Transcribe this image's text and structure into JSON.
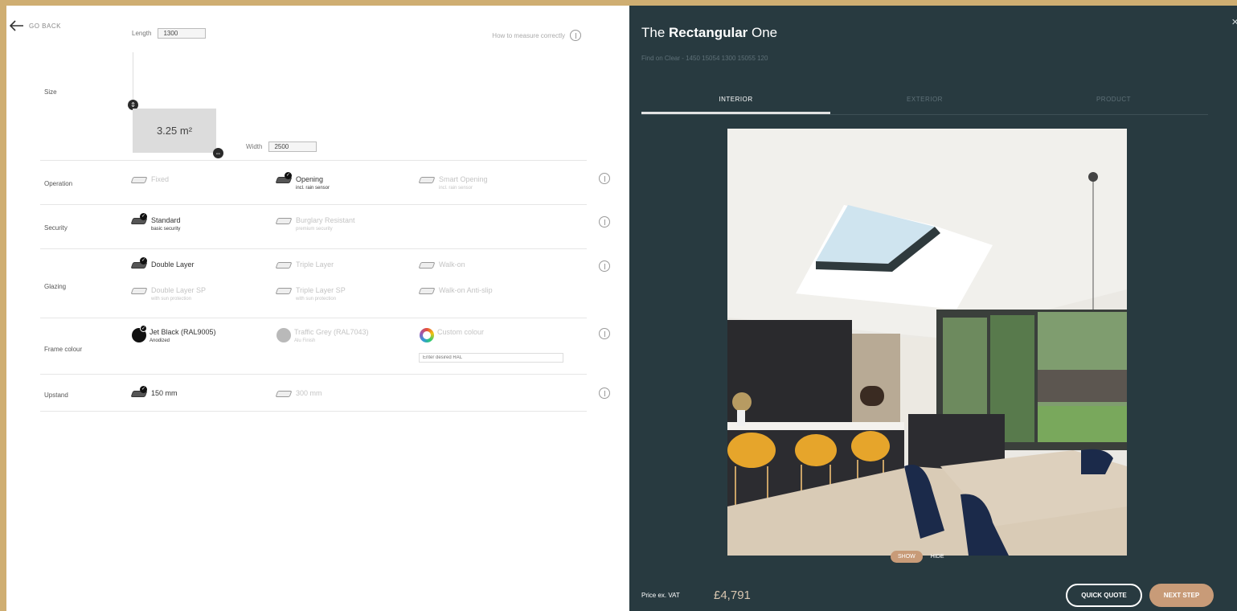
{
  "left": {
    "back_label": "GO BACK",
    "length_label": "Length",
    "length_value": "1300",
    "width_label": "Width",
    "width_value": "2500",
    "measure_link": "How to measure correctly",
    "size_label": "Size",
    "area": "3.25 m²",
    "rows": {
      "operation": {
        "label": "Operation",
        "options": [
          {
            "name": "Fixed",
            "sub": ""
          },
          {
            "name": "Opening",
            "sub": "incl. rain sensor"
          },
          {
            "name": "Smart Opening",
            "sub": "incl. rain sensor"
          }
        ]
      },
      "security": {
        "label": "Security",
        "options": [
          {
            "name": "Standard",
            "sub": "basic security"
          },
          {
            "name": "Burglary Resistant",
            "sub": "premium security"
          }
        ]
      },
      "glazing": {
        "label": "Glazing",
        "options": [
          {
            "name": "Double Layer",
            "sub": ""
          },
          {
            "name": "Triple Layer",
            "sub": ""
          },
          {
            "name": "Walk-on",
            "sub": ""
          },
          {
            "name": "Double Layer SP",
            "sub": "with sun protection"
          },
          {
            "name": "Triple Layer SP",
            "sub": "with sun protection"
          },
          {
            "name": "Walk-on Anti-slip",
            "sub": ""
          }
        ]
      },
      "frame": {
        "label": "Frame colour",
        "options": [
          {
            "name": "Jet Black (RAL9005)",
            "sub": "Anodized"
          },
          {
            "name": "Traffic Grey (RAL7043)",
            "sub": "Alu Finish"
          },
          {
            "name": "Custom colour",
            "sub": ""
          }
        ],
        "custom_placeholder": "Enter desired RAL"
      },
      "upstand": {
        "label": "Upstand",
        "options": [
          {
            "name": "150 mm",
            "sub": ""
          },
          {
            "name": "300 mm",
            "sub": ""
          }
        ]
      }
    }
  },
  "right": {
    "title_pre": "The ",
    "title_bold": "Rectangular",
    "title_post": " One",
    "subtitle": "Find on Clear - 1450 15054 1300 15055 120",
    "close": "×",
    "tabs": [
      "INTERIOR",
      "EXTERIOR",
      "PRODUCT"
    ],
    "show": "SHOW",
    "hide": "HIDE",
    "price_label": "Price ex. VAT",
    "price": "£4,791",
    "quick_quote": "QUICK QUOTE",
    "next_step": "NEXT STEP"
  },
  "colors": {
    "panel_dark": "#283a40",
    "accent": "#c89b78",
    "frame_gold": "#cfae72",
    "jet_black": "#111111",
    "traffic_grey": "#b9b9b9"
  }
}
